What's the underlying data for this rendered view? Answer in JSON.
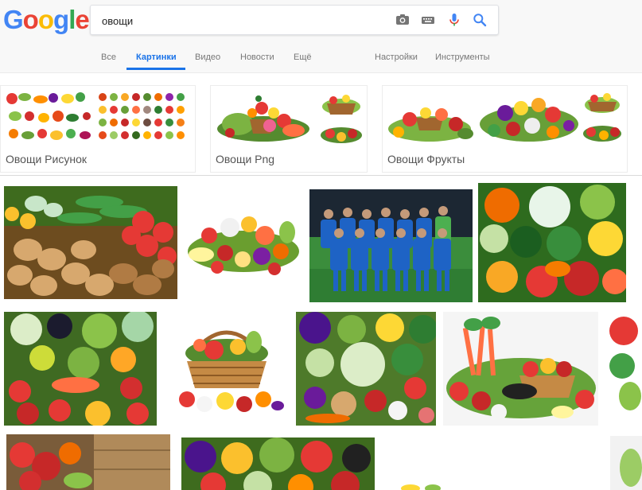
{
  "search": {
    "query": "овощи"
  },
  "logo": {
    "letters": [
      "G",
      "o",
      "o",
      "g",
      "l",
      "e"
    ],
    "colors": [
      "#4285f4",
      "#ea4335",
      "#fbbc05",
      "#4285f4",
      "#34a853",
      "#ea4335"
    ]
  },
  "tabs": {
    "all": "Все",
    "images": "Картинки",
    "video": "Видео",
    "news": "Новости",
    "more": "Ещё",
    "settings": "Настройки",
    "tools": "Инструменты"
  },
  "related": [
    {
      "label": "Овощи Рисунок"
    },
    {
      "label": "Овощи Png"
    },
    {
      "label": "Овощи Фрукты"
    }
  ],
  "colors": {
    "accent": "#1a73e8",
    "tab_text": "#777777",
    "mic": "#ea4335"
  }
}
